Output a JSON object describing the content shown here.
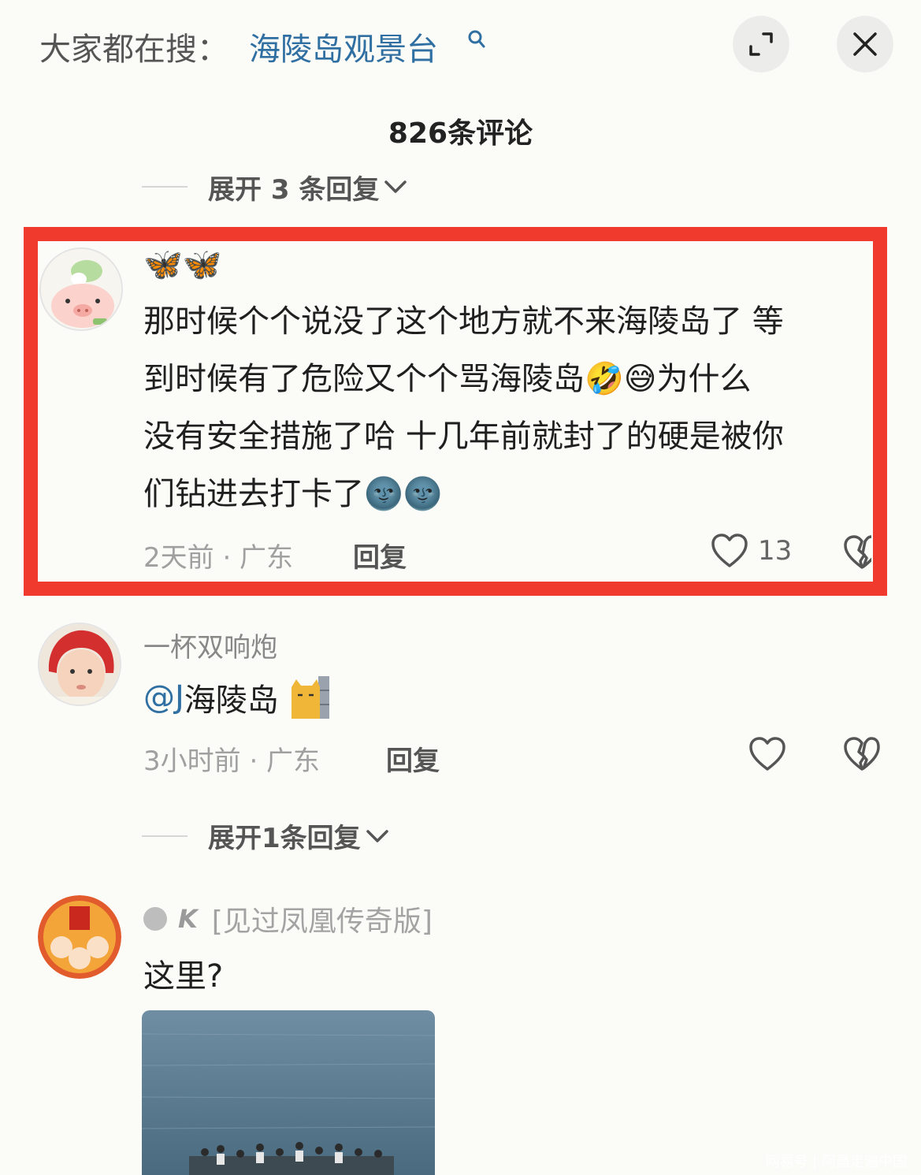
{
  "header": {
    "search_prefix": "大家都在搜：",
    "search_term": "海陵岛观景台"
  },
  "comments_title": "826条评论",
  "top_expand": {
    "label": "展开 3 条回复"
  },
  "comments": [
    {
      "username_emoji": "🦋🦋",
      "text_lines": [
        "那时候个个说没了这个地方就不来海陵岛了 等",
        "到时候有了危险又个个骂海陵岛🤣😅为什么",
        "没有安全措施了哈 十几年前就封了的硬是被你",
        "们钻进去打卡了🌚🌚"
      ],
      "time_location": "2天前 · 广东",
      "reply_label": "回复",
      "like_count": "13"
    },
    {
      "username": "一杯双响炮",
      "mention": "@J",
      "text": " 海陵岛",
      "time_location": "3小时前 · 广东",
      "reply_label": "回复"
    },
    {
      "username_initial": "K",
      "username_badge": "[见过凤凰传奇版]",
      "text": "这里?"
    }
  ],
  "second_expand": {
    "label": "展开1条回复"
  },
  "watermark": "网易号 | 阿昌走遍中国",
  "colors": {
    "highlight_border": "#f03a2e",
    "link_blue": "#2f6fa2",
    "background": "#fbfbf7"
  }
}
